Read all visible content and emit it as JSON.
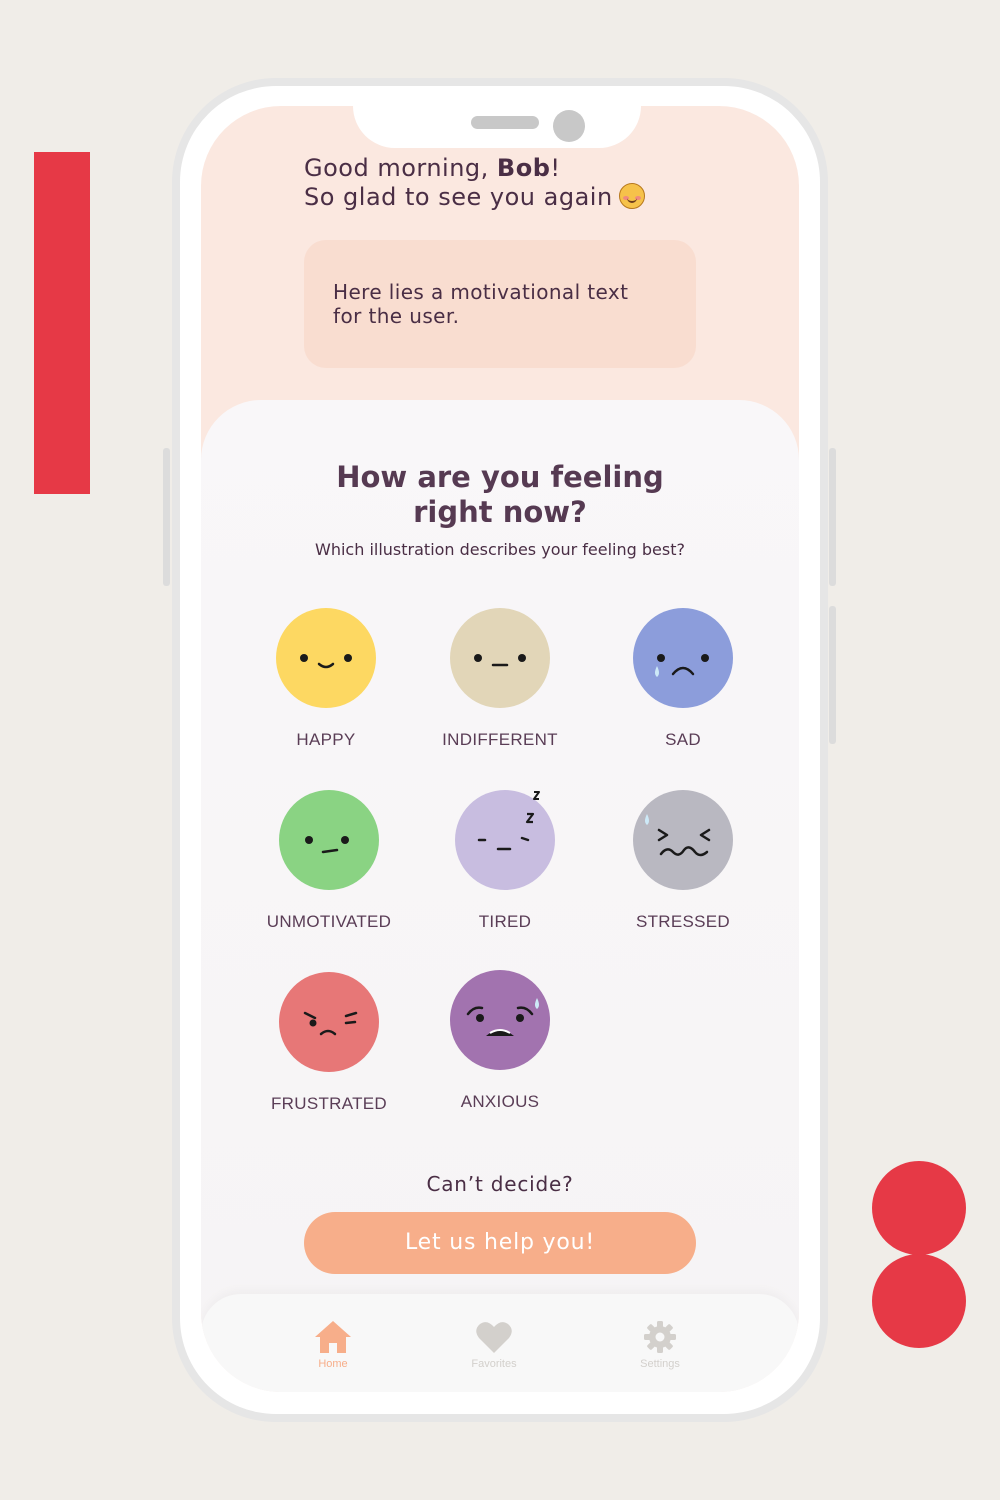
{
  "greeting": {
    "line1_prefix": "Good morning, ",
    "user_name": "Bob",
    "line1_suffix": "!",
    "line2": "So glad to see you again"
  },
  "motivation": {
    "line1": "Here lies a motivational text",
    "line2": "for the user."
  },
  "mood_card": {
    "title_line1": "How are you feeling",
    "title_line2": "right now?",
    "subtitle": "Which illustration describes your feeling best?",
    "moods": [
      {
        "label": "HAPPY",
        "color": "#fdd862"
      },
      {
        "label": "INDIFFERENT",
        "color": "#e2d6b8"
      },
      {
        "label": "SAD",
        "color": "#8c9ddb"
      },
      {
        "label": "UNMOTIVATED",
        "color": "#8ad383"
      },
      {
        "label": "TIRED",
        "color": "#c8bde0"
      },
      {
        "label": "STRESSED",
        "color": "#b9b8c1"
      },
      {
        "label": "FRUSTRATED",
        "color": "#e77777"
      },
      {
        "label": "ANXIOUS",
        "color": "#a273af"
      }
    ]
  },
  "help": {
    "question": "Can’t decide?",
    "button_label": "Let us help you!"
  },
  "nav": {
    "items": [
      {
        "label": "Home",
        "icon": "home-icon",
        "active": true
      },
      {
        "label": "Favorites",
        "icon": "heart-icon",
        "active": false
      },
      {
        "label": "Settings",
        "icon": "gear-icon",
        "active": false
      }
    ]
  },
  "colors": {
    "accent": "#f7ae8a",
    "decor_red": "#e63946",
    "text": "#4a2e45",
    "nav_inactive": "#d3d0cc"
  }
}
